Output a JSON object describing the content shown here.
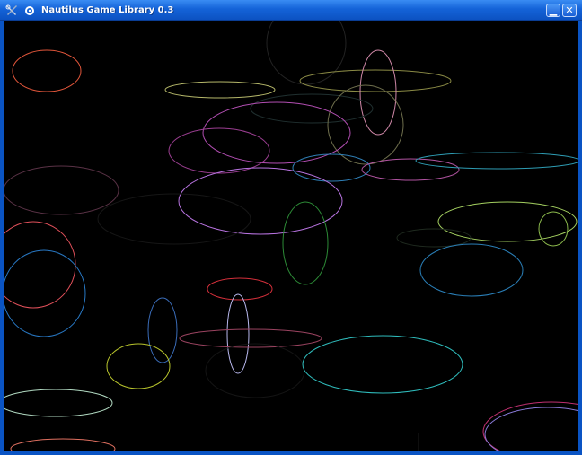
{
  "window": {
    "title": "Nautilus Game Library 0.3",
    "app_icon": "tools-icon",
    "menu_icon": "window-menu-icon",
    "minimize_glyph": "▁",
    "close_glyph": "✕"
  },
  "colors": {
    "titlebar": "#1463d8",
    "canvas_background": "#000000"
  }
}
